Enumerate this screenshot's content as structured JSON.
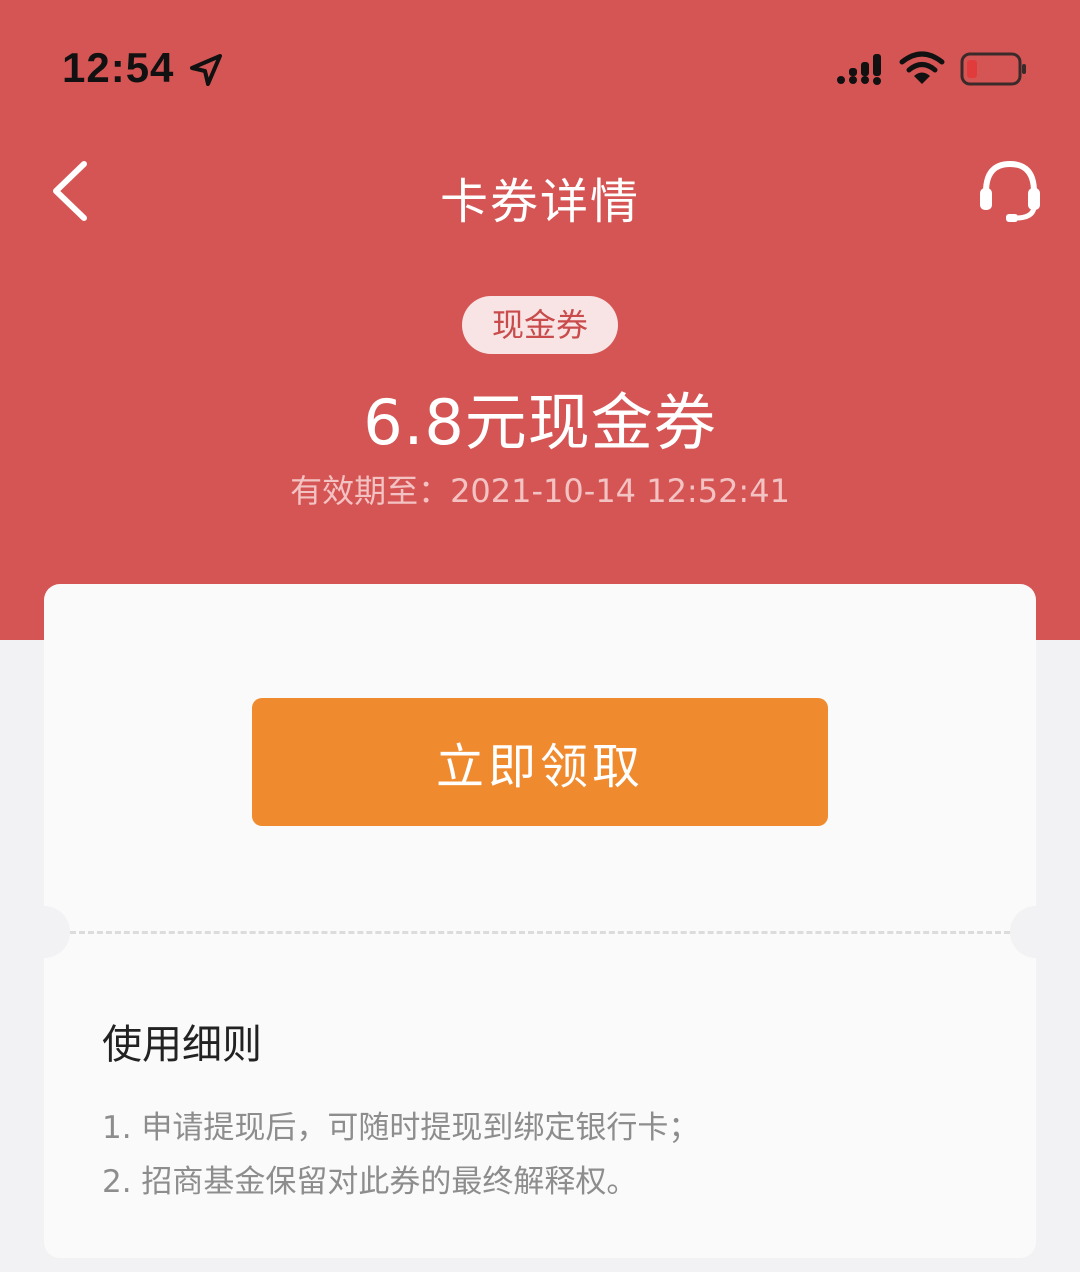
{
  "status_bar": {
    "time": "12:54",
    "icons": [
      "location-arrow-icon",
      "signal-icon",
      "wifi-icon",
      "battery-low-icon"
    ]
  },
  "nav": {
    "title": "卡券详情",
    "back_icon": "chevron-left-icon",
    "support_icon": "headset-icon"
  },
  "coupon": {
    "tag": "现金券",
    "title": "6.8元现金券",
    "validity": "有效期至：2021-10-14 12:52:41"
  },
  "actions": {
    "claim_label": "立即领取"
  },
  "rules": {
    "title": "使用细则",
    "items": [
      "1. 申请提现后，可随时提现到绑定银行卡；",
      "2. 招商基金保留对此券的最终解释权。"
    ]
  },
  "colors": {
    "header_bg": "#d55555",
    "button": "#f08a2e",
    "tag_bg": "#f8e4e4",
    "tag_text": "#c94b4b",
    "battery_low": "#e23b3b"
  }
}
